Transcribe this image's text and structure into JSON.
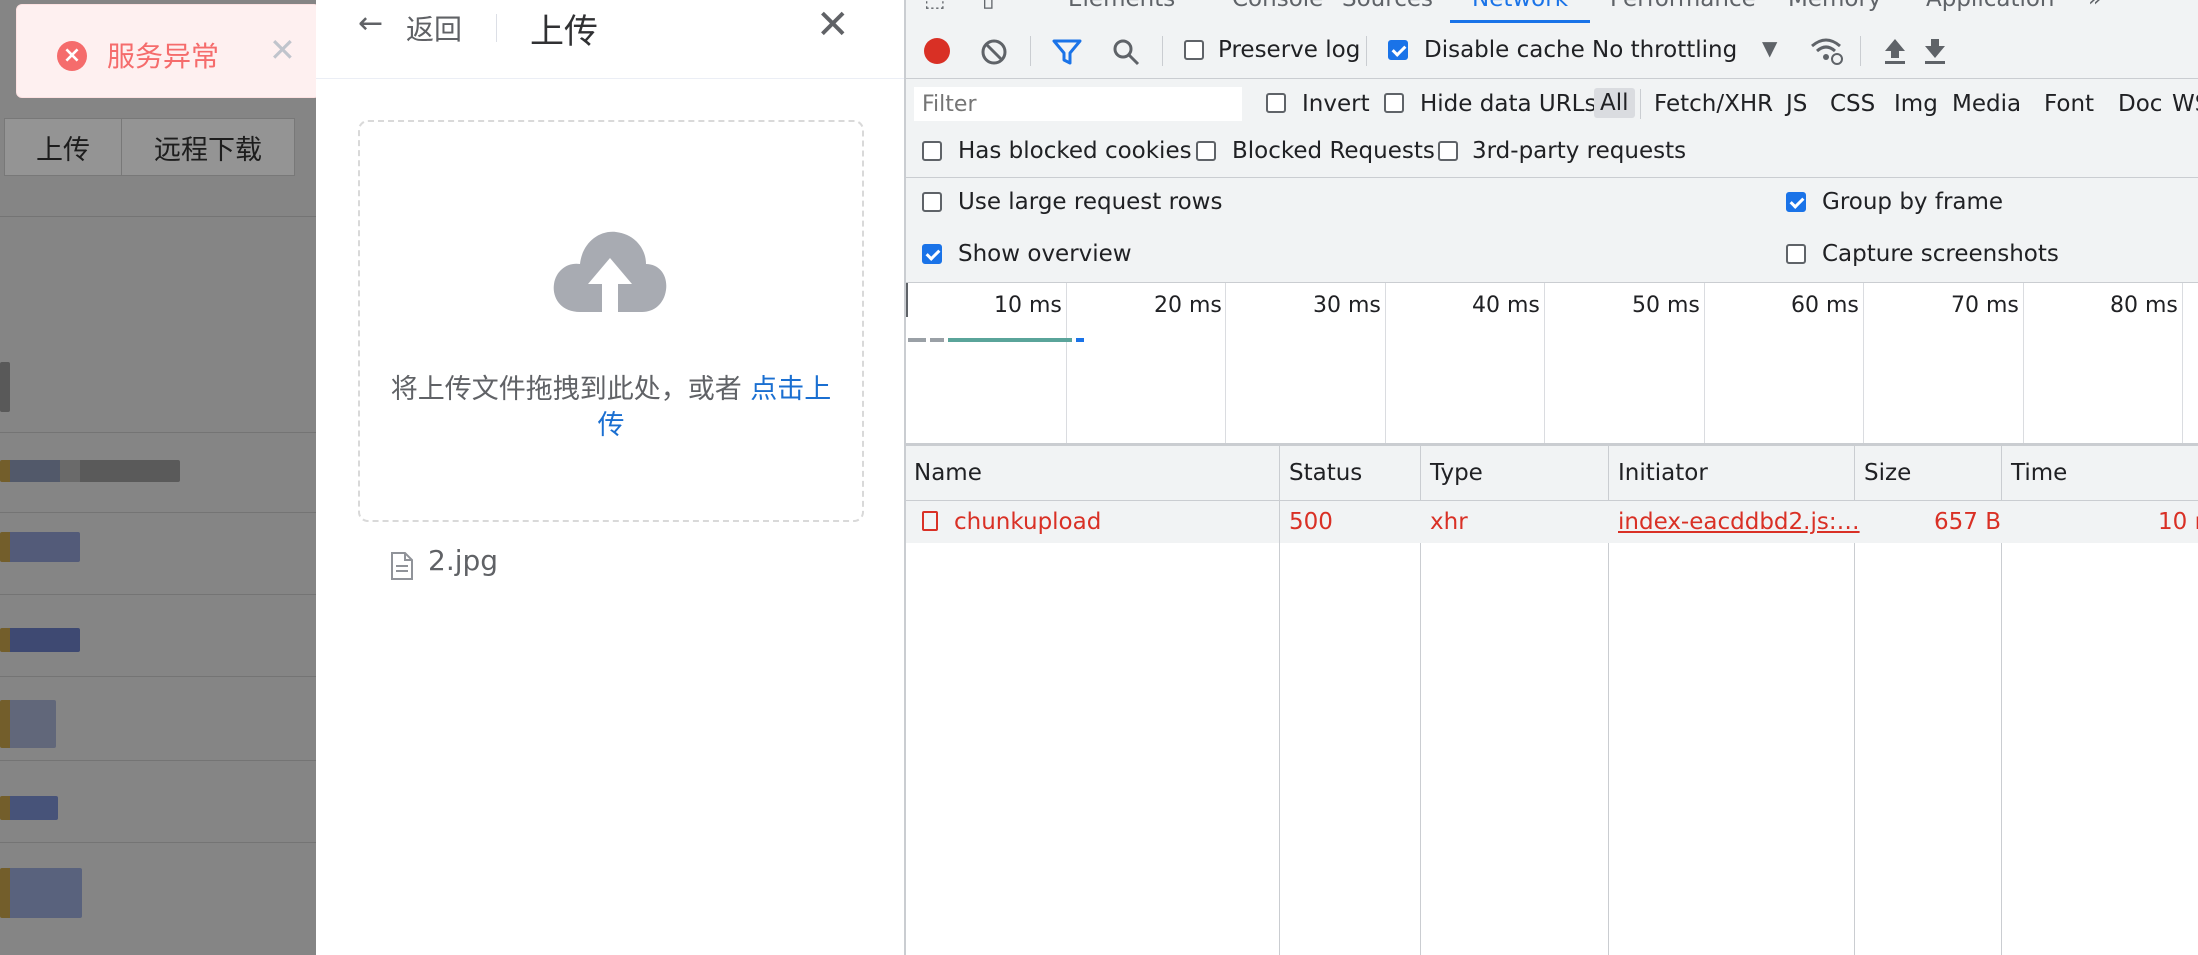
{
  "app": {
    "tabs": [
      "上传",
      "远程下载"
    ]
  },
  "toast": {
    "message": "服务异常",
    "icon": "error-circle-icon",
    "close_icon": "close-icon",
    "color": "#f56c6c"
  },
  "drawer": {
    "back_label": "返回",
    "title": "上传",
    "dropzone": {
      "icon": "cloud-upload-icon",
      "hint": "将上传文件拖拽到此处，或者 ",
      "link": "点击上传"
    },
    "files": [
      {
        "name": "2.jpg",
        "icon": "document-icon"
      }
    ]
  },
  "devtools": {
    "tabs": [
      "Elements",
      "Console",
      "Sources",
      "Network",
      "Performance",
      "Memory",
      "Application"
    ],
    "active_tab": "Network",
    "more": "»",
    "toolbar": {
      "preserve_log": "Preserve log",
      "disable_cache": "Disable cache",
      "throttling": "No throttling"
    },
    "filter": {
      "placeholder": "Filter",
      "invert": "Invert",
      "hide_data_urls": "Hide data URLs",
      "types": [
        "All",
        "Fetch/XHR",
        "JS",
        "CSS",
        "Img",
        "Media",
        "Font",
        "Doc",
        "WS"
      ],
      "has_blocked_cookies": "Has blocked cookies",
      "blocked_requests": "Blocked Requests",
      "third_party": "3rd-party requests"
    },
    "settings": {
      "large_rows": "Use large request rows",
      "show_overview": "Show overview",
      "group_by_frame": "Group by frame",
      "capture_screenshots": "Capture screenshots"
    },
    "overview_ticks": [
      "10 ms",
      "20 ms",
      "30 ms",
      "40 ms",
      "50 ms",
      "60 ms",
      "70 ms",
      "80 ms"
    ],
    "columns": [
      "Name",
      "Status",
      "Type",
      "Initiator",
      "Size",
      "Time"
    ],
    "rows": [
      {
        "name": "chunkupload",
        "status": "500",
        "type": "xhr",
        "initiator": "index-eacddbd2.js:…",
        "size": "657 B",
        "time": "10 r"
      }
    ],
    "error_color": "#d93025",
    "accent": "#1a73e8"
  }
}
